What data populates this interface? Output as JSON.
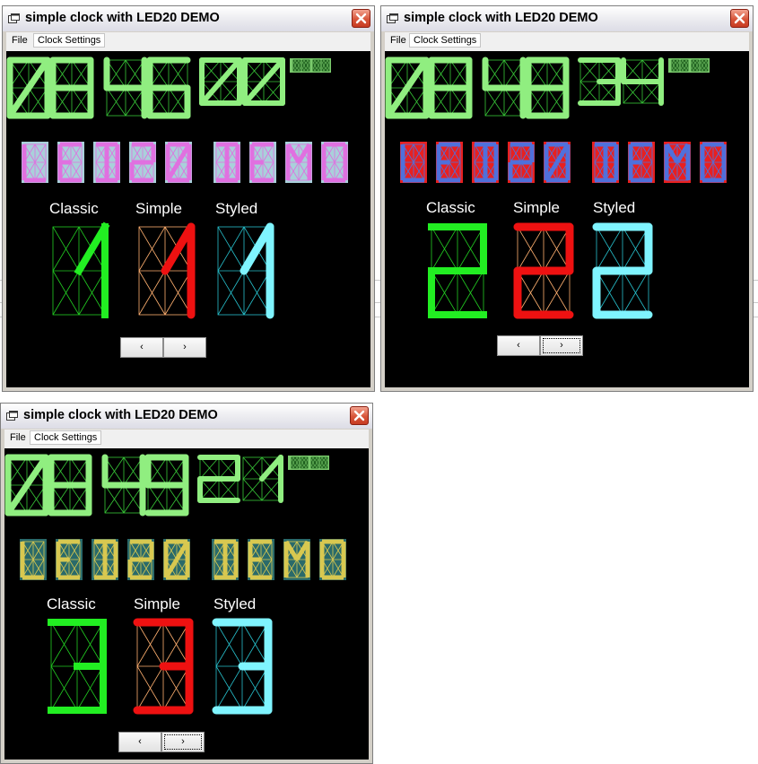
{
  "windows": [
    {
      "title": "simple clock with LED20 DEMO",
      "menu": [
        "File",
        "Clock Settings"
      ],
      "clock": {
        "hours": "08",
        "minutes": "46",
        "seconds": "00"
      },
      "banner": {
        "text": "LED20 DEMO",
        "segment_color": "#e070e0",
        "panel_color": "#a9d0da"
      },
      "styles": [
        {
          "label": "Classic",
          "digit": "1",
          "color": "#22ee22"
        },
        {
          "label": "Simple",
          "digit": "1",
          "color": "#ee1111"
        },
        {
          "label": "Styled",
          "digit": "1",
          "color": "#7ff4ff"
        }
      ],
      "nav": {
        "prev_label": "‹",
        "next_label": "›",
        "focused": "none"
      }
    },
    {
      "title": "simple clock with LED20 DEMO",
      "menu": [
        "File",
        "Clock Settings"
      ],
      "clock": {
        "hours": "08",
        "minutes": "48",
        "seconds": "34"
      },
      "banner": {
        "text": "LED20 DEMO",
        "segment_color": "#4f70dc",
        "panel_color": "#e82020"
      },
      "styles": [
        {
          "label": "Classic",
          "digit": "2",
          "color": "#22ee22"
        },
        {
          "label": "Simple",
          "digit": "2",
          "color": "#ee1111"
        },
        {
          "label": "Styled",
          "digit": "2",
          "color": "#7ff4ff"
        }
      ],
      "nav": {
        "prev_label": "‹",
        "next_label": "›",
        "focused": "next"
      }
    },
    {
      "title": "simple clock with LED20 DEMO",
      "menu": [
        "File",
        "Clock Settings"
      ],
      "clock": {
        "hours": "08",
        "minutes": "49",
        "seconds": "21"
      },
      "banner": {
        "text": "LED20 DEMO",
        "segment_color": "#d8c850",
        "panel_color": "#2a6a6a"
      },
      "styles": [
        {
          "label": "Classic",
          "digit": "3",
          "color": "#22ee22"
        },
        {
          "label": "Simple",
          "digit": "3",
          "color": "#ee1111"
        },
        {
          "label": "Styled",
          "digit": "3",
          "color": "#7ff4ff"
        }
      ],
      "nav": {
        "prev_label": "‹",
        "next_label": "›",
        "focused": "next"
      }
    }
  ],
  "colors": {
    "clock_segment": "#90ee80",
    "clock_grid": "#38c838",
    "classic_grid": "#22cc22",
    "simple_grid": "#ffb070",
    "styled_grid": "#27c0cc"
  },
  "icons": {
    "window": "window-icon",
    "close": "close-icon"
  }
}
